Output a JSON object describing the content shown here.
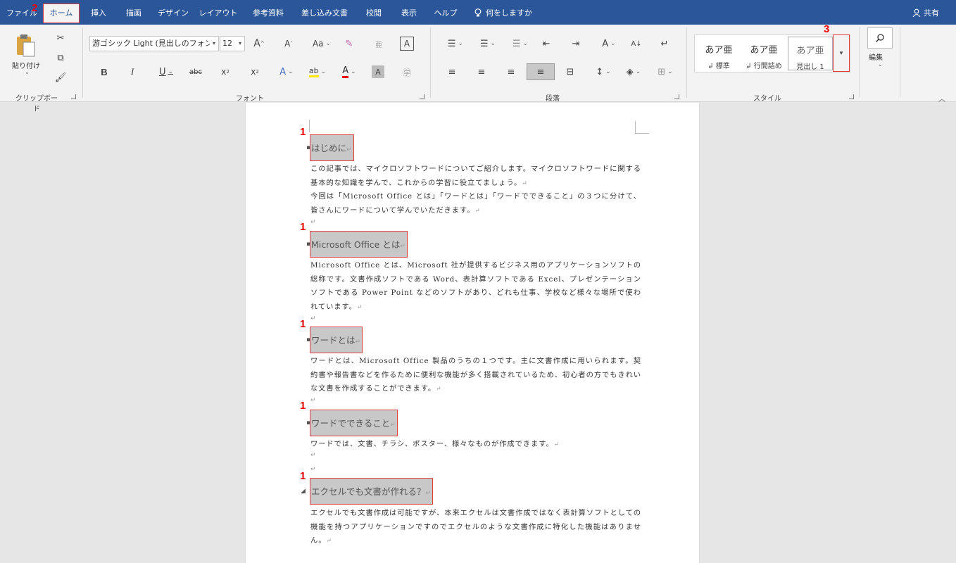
{
  "tabs": {
    "file": "ファイル",
    "home": "ホーム",
    "insert": "挿入",
    "draw": "描画",
    "design": "デザイン",
    "layout": "レイアウト",
    "references": "参考資料",
    "mailings": "差し込み文書",
    "review": "校閲",
    "view": "表示",
    "help": "ヘルプ",
    "tell_me": "何をしますか",
    "share": "共有"
  },
  "ribbon": {
    "clipboard": {
      "label": "クリップボード",
      "paste": "貼り付け"
    },
    "font": {
      "label": "フォント",
      "font_name": "游ゴシック Light (見出しのフォント - 日",
      "font_size": "12",
      "grow": "A",
      "shrink": "A",
      "change_case": "Aa",
      "bold": "B",
      "italic": "I",
      "underline": "U",
      "strike": "abc",
      "subscript": "x",
      "superscript": "x",
      "font_color": "A"
    },
    "paragraph": {
      "label": "段落"
    },
    "styles": {
      "label": "スタイル",
      "items": [
        {
          "sample": "あア亜",
          "name": "↲ 標準"
        },
        {
          "sample": "あア亜",
          "name": "↲ 行間詰め"
        },
        {
          "sample": "あア亜",
          "name": "見出し 1"
        }
      ]
    },
    "editing": {
      "label": "編集"
    }
  },
  "markers": {
    "style_markers": "1",
    "home_marker": "2",
    "more_marker": "3"
  },
  "document": {
    "sections": [
      {
        "heading": "はじめに",
        "paragraphs": [
          "この記事では、マイクロソフトワードについてご紹介します。マイクロソフトワードに関する基本的な知識を学んで、これからの学習に役立てましょう。",
          "今回は「Microsoft Office とは」「ワードとは」「ワードでできること」の３つに分けて、皆さんにワードについて学んでいただきます。"
        ]
      },
      {
        "heading": "Microsoft Office とは",
        "paragraphs": [
          "Microsoft Office とは、Microsoft 社が提供するビジネス用のアプリケーションソフトの総称です。文書作成ソフトである Word、表計算ソフトである Excel、プレゼンテーションソフトである Power Point などのソフトがあり、どれも仕事、学校など様々な場所で使われています。"
        ]
      },
      {
        "heading": "ワードとは",
        "paragraphs": [
          "ワードとは、Microsoft Office 製品のうちの１つです。主に文書作成に用いられます。契約書や報告書などを作るために便利な機能が多く搭載されているため、初心者の方でもきれいな文書を作成することができます。"
        ]
      },
      {
        "heading": "ワードでできること",
        "paragraphs": [
          "ワードでは、文書、チラシ、ポスター、様々なものが作成できます。"
        ]
      },
      {
        "heading": "エクセルでも文書が作れる？",
        "paragraphs": [
          "エクセルでも文書作成は可能ですが、本来エクセルは文書作成ではなく表計算ソフトとしての機能を持つアプリケーションですのでエクセルのような文書作成に特化した機能はありません。"
        ]
      }
    ],
    "return_mark": "↵"
  },
  "colors": {
    "accent": "#2b579a",
    "highlight_border": "#e23b3b",
    "marker": "#e00000"
  }
}
